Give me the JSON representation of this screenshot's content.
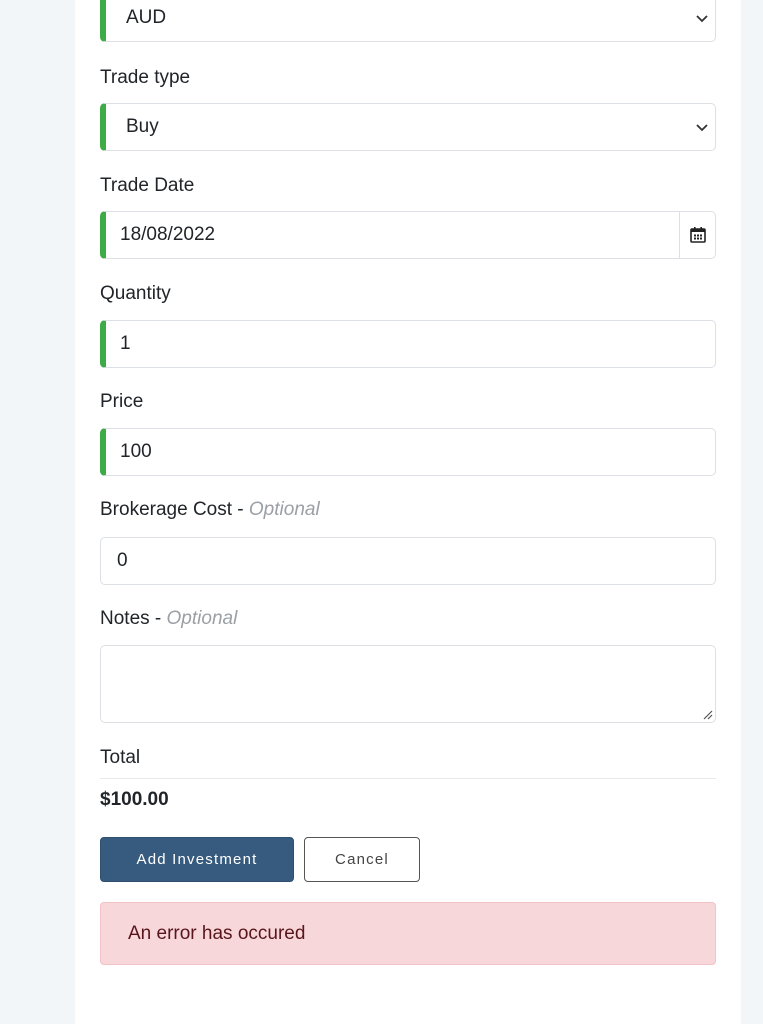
{
  "form": {
    "currency": {
      "value": "AUD",
      "icon": "chevron-down-icon"
    },
    "trade_type": {
      "label": "Trade type",
      "value": "Buy",
      "icon": "chevron-down-icon"
    },
    "trade_date": {
      "label": "Trade Date",
      "value": "18/08/2022",
      "icon": "calendar-icon"
    },
    "quantity": {
      "label": "Quantity",
      "value": "1"
    },
    "price": {
      "label": "Price",
      "value": "100"
    },
    "brokerage": {
      "label": "Brokerage Cost - ",
      "optional": "Optional",
      "value": "0"
    },
    "notes": {
      "label": "Notes - ",
      "optional": "Optional",
      "value": ""
    },
    "total": {
      "label": "Total",
      "value": "$100.00"
    }
  },
  "buttons": {
    "add": "Add Investment",
    "cancel": "Cancel"
  },
  "alert": {
    "message": "An error has occured"
  },
  "colors": {
    "valid": "#3dab46",
    "primary": "#365b7e",
    "alert_bg": "#f8d7da",
    "alert_text": "#58151c"
  }
}
